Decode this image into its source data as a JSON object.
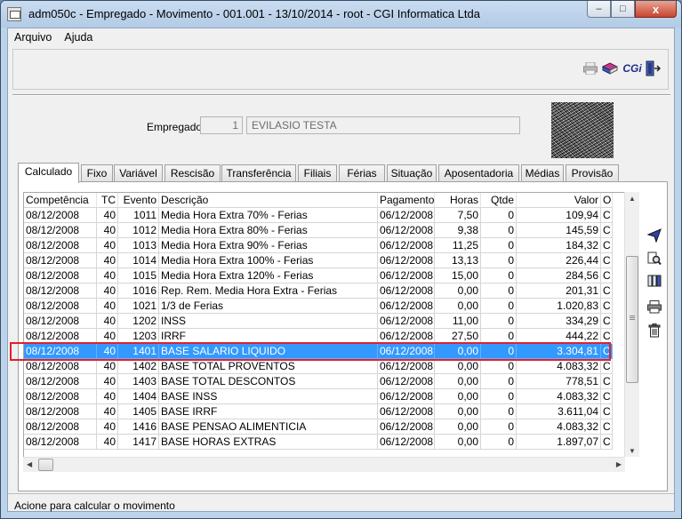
{
  "window": {
    "title": "adm050c - Empregado - Movimento - 001.001 - 13/10/2014 - root - CGI Informatica Ltda",
    "buttons": {
      "minimize": "–",
      "maximize": "□",
      "close": "x"
    }
  },
  "menu": [
    "Arquivo",
    "Ajuda"
  ],
  "toolbar": {
    "icons": [
      "printer-icon",
      "books-icon",
      "cgi-logo-icon",
      "exit-door-icon"
    ],
    "cgi_label": "CGi"
  },
  "employee": {
    "label": "Empregado:",
    "code": "1",
    "name": "EVILASIO TESTA"
  },
  "tabs": [
    "Calculado",
    "Fixo",
    "Variável",
    "Rescisão",
    "Transferência",
    "Filiais",
    "Férias",
    "Situação",
    "Aposentadoria",
    "Médias",
    "Provisão"
  ],
  "grid": {
    "columns": [
      "Competência",
      "TC",
      "Evento",
      "Descrição",
      "Pagamento",
      "Horas",
      "Qtde",
      "Valor",
      "O"
    ],
    "rows": [
      [
        "08/12/2008",
        "40",
        "1011",
        "Media Hora Extra 70% - Ferias",
        "06/12/2008",
        "7,50",
        "0",
        "109,94",
        "C"
      ],
      [
        "08/12/2008",
        "40",
        "1012",
        "Media Hora Extra 80% - Ferias",
        "06/12/2008",
        "9,38",
        "0",
        "145,59",
        "C"
      ],
      [
        "08/12/2008",
        "40",
        "1013",
        "Media Hora Extra 90% - Ferias",
        "06/12/2008",
        "11,25",
        "0",
        "184,32",
        "C"
      ],
      [
        "08/12/2008",
        "40",
        "1014",
        "Media Hora Extra 100% - Ferias",
        "06/12/2008",
        "13,13",
        "0",
        "226,44",
        "C"
      ],
      [
        "08/12/2008",
        "40",
        "1015",
        "Media Hora Extra 120% - Ferias",
        "06/12/2008",
        "15,00",
        "0",
        "284,56",
        "C"
      ],
      [
        "08/12/2008",
        "40",
        "1016",
        "Rep. Rem. Media Hora Extra - Ferias",
        "06/12/2008",
        "0,00",
        "0",
        "201,31",
        "C"
      ],
      [
        "08/12/2008",
        "40",
        "1021",
        "1/3 de Ferias",
        "06/12/2008",
        "0,00",
        "0",
        "1.020,83",
        "C"
      ],
      [
        "08/12/2008",
        "40",
        "1202",
        "INSS",
        "06/12/2008",
        "11,00",
        "0",
        "334,29",
        "C"
      ],
      [
        "08/12/2008",
        "40",
        "1203",
        "IRRF",
        "06/12/2008",
        "27,50",
        "0",
        "444,22",
        "C"
      ],
      [
        "08/12/2008",
        "40",
        "1401",
        "BASE SALARIO LIQUIDO",
        "06/12/2008",
        "0,00",
        "0",
        "3.304,81",
        "C"
      ],
      [
        "08/12/2008",
        "40",
        "1402",
        "BASE TOTAL PROVENTOS",
        "06/12/2008",
        "0,00",
        "0",
        "4.083,32",
        "C"
      ],
      [
        "08/12/2008",
        "40",
        "1403",
        "BASE TOTAL DESCONTOS",
        "06/12/2008",
        "0,00",
        "0",
        "778,51",
        "C"
      ],
      [
        "08/12/2008",
        "40",
        "1404",
        "BASE INSS",
        "06/12/2008",
        "0,00",
        "0",
        "4.083,32",
        "C"
      ],
      [
        "08/12/2008",
        "40",
        "1405",
        "BASE IRRF",
        "06/12/2008",
        "0,00",
        "0",
        "3.611,04",
        "C"
      ],
      [
        "08/12/2008",
        "40",
        "1416",
        "BASE PENSAO ALIMENTICIA",
        "06/12/2008",
        "0,00",
        "0",
        "4.083,32",
        "C"
      ],
      [
        "08/12/2008",
        "40",
        "1417",
        "BASE HORAS EXTRAS",
        "06/12/2008",
        "0,00",
        "0",
        "1.897,07",
        "C"
      ]
    ],
    "selected_row": 9
  },
  "side_icons": [
    "send-icon",
    "search-document-icon",
    "columns-edit-icon",
    "printer-icon",
    "trash-icon"
  ],
  "status": "Acione para calcular o movimento"
}
